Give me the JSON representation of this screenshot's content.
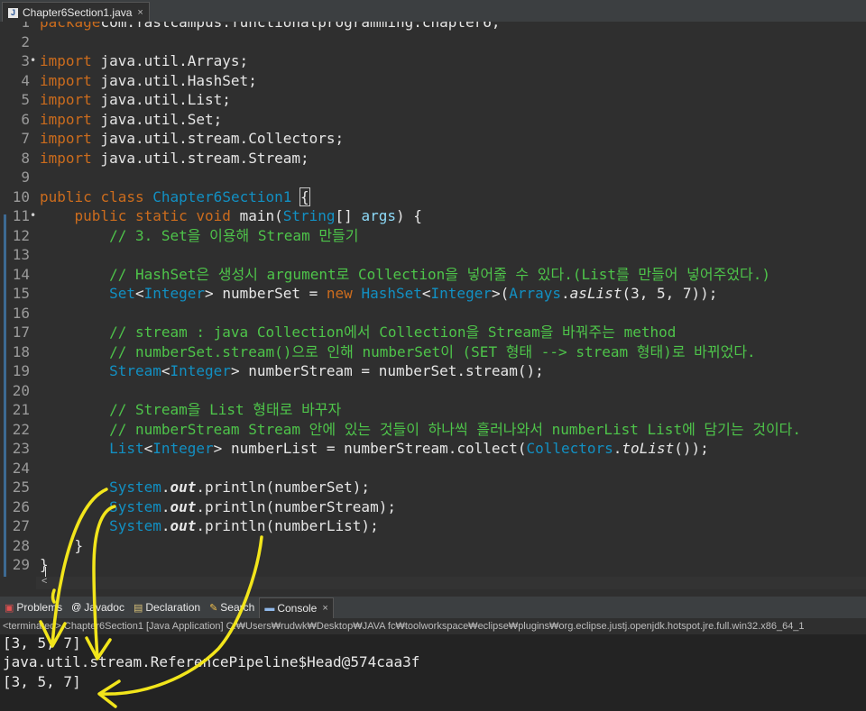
{
  "editor": {
    "tab_title": "Chapter6Section1.java",
    "tab_close": "×",
    "lines": [
      {
        "n": "1",
        "fold": "",
        "t": [
          [
            "kw",
            "package"
          ],
          [
            "",
            "com.fastcampus.functionalprogramming.chapter6;"
          ]
        ]
      },
      {
        "n": "2",
        "fold": "",
        "t": []
      },
      {
        "n": "3",
        "fold": "•",
        "t": [
          [
            "kw",
            "import"
          ],
          [
            "",
            " java.util.Arrays;"
          ]
        ]
      },
      {
        "n": "4",
        "fold": "",
        "t": [
          [
            "kw",
            "import"
          ],
          [
            "",
            " java.util.HashSet;"
          ]
        ]
      },
      {
        "n": "5",
        "fold": "",
        "t": [
          [
            "kw",
            "import"
          ],
          [
            "",
            " java.util.List;"
          ]
        ]
      },
      {
        "n": "6",
        "fold": "",
        "t": [
          [
            "kw",
            "import"
          ],
          [
            "",
            " java.util.Set;"
          ]
        ]
      },
      {
        "n": "7",
        "fold": "",
        "t": [
          [
            "kw",
            "import"
          ],
          [
            "",
            " java.util.stream.Collectors;"
          ]
        ]
      },
      {
        "n": "8",
        "fold": "",
        "t": [
          [
            "kw",
            "import"
          ],
          [
            "",
            " java.util.stream.Stream;"
          ]
        ]
      },
      {
        "n": "9",
        "fold": "",
        "t": []
      },
      {
        "n": "10",
        "fold": "",
        "t": [
          [
            "kw",
            "public"
          ],
          [
            "",
            " "
          ],
          [
            "kw",
            "class"
          ],
          [
            "",
            " "
          ],
          [
            "ty",
            "Chapter6Section1"
          ],
          [
            "",
            " "
          ],
          [
            "box",
            "{"
          ]
        ]
      },
      {
        "n": "11",
        "fold": "•",
        "t": [
          [
            "",
            "    "
          ],
          [
            "kw",
            "public"
          ],
          [
            "",
            " "
          ],
          [
            "kw",
            "static"
          ],
          [
            "",
            " "
          ],
          [
            "kw",
            "void"
          ],
          [
            "",
            " main("
          ],
          [
            "ty",
            "String"
          ],
          [
            "",
            "[] "
          ],
          [
            "fd",
            "args"
          ],
          [
            "",
            ") {"
          ]
        ]
      },
      {
        "n": "12",
        "fold": "",
        "t": [
          [
            "",
            "        "
          ],
          [
            "cm",
            "// 3. Set을 이용해 Stream 만들기"
          ]
        ]
      },
      {
        "n": "13",
        "fold": "",
        "t": []
      },
      {
        "n": "14",
        "fold": "",
        "t": [
          [
            "",
            "        "
          ],
          [
            "cm",
            "// HashSet은 생성시 argument로 Collection을 넣어줄 수 있다.(List를 만들어 넣어주었다.)"
          ]
        ]
      },
      {
        "n": "15",
        "fold": "",
        "t": [
          [
            "",
            "        "
          ],
          [
            "ty",
            "Set"
          ],
          [
            "",
            "<"
          ],
          [
            "ty",
            "Integer"
          ],
          [
            "",
            "> numberSet = "
          ],
          [
            "kw",
            "new"
          ],
          [
            "",
            " "
          ],
          [
            "ty",
            "HashSet"
          ],
          [
            "",
            "<"
          ],
          [
            "ty",
            "Integer"
          ],
          [
            "",
            ">("
          ],
          [
            "ty",
            "Arrays"
          ],
          [
            "",
            "."
          ],
          [
            "it",
            "asList"
          ],
          [
            "",
            "(3, 5, 7));"
          ]
        ]
      },
      {
        "n": "16",
        "fold": "",
        "t": []
      },
      {
        "n": "17",
        "fold": "",
        "t": [
          [
            "",
            "        "
          ],
          [
            "cm",
            "// stream : java Collection에서 Collection을 Stream을 바꿔주는 method"
          ]
        ]
      },
      {
        "n": "18",
        "fold": "",
        "t": [
          [
            "",
            "        "
          ],
          [
            "cm",
            "// numberSet.stream()으로 인해 numberSet이 (SET 형태 --> stream 형태)로 바뀌었다."
          ]
        ]
      },
      {
        "n": "19",
        "fold": "",
        "t": [
          [
            "",
            "        "
          ],
          [
            "ty",
            "Stream"
          ],
          [
            "",
            "<"
          ],
          [
            "ty",
            "Integer"
          ],
          [
            "",
            "> numberStream = numberSet.stream();"
          ]
        ]
      },
      {
        "n": "20",
        "fold": "",
        "t": []
      },
      {
        "n": "21",
        "fold": "",
        "t": [
          [
            "",
            "        "
          ],
          [
            "cm",
            "// Stream을 List 형태로 바꾸자"
          ]
        ]
      },
      {
        "n": "22",
        "fold": "",
        "t": [
          [
            "",
            "        "
          ],
          [
            "cm",
            "// numberStream Stream 안에 있는 것들이 하나씩 흘러나와서 numberList List에 담기는 것이다."
          ]
        ]
      },
      {
        "n": "23",
        "fold": "",
        "t": [
          [
            "",
            "        "
          ],
          [
            "ty",
            "List"
          ],
          [
            "",
            "<"
          ],
          [
            "ty",
            "Integer"
          ],
          [
            "",
            "> numberList = numberStream.collect("
          ],
          [
            "ty",
            "Collectors"
          ],
          [
            "",
            "."
          ],
          [
            "it",
            "toList"
          ],
          [
            "",
            "());"
          ]
        ]
      },
      {
        "n": "24",
        "fold": "",
        "t": []
      },
      {
        "n": "25",
        "fold": "",
        "t": [
          [
            "",
            "        "
          ],
          [
            "ty",
            "System"
          ],
          [
            "",
            "."
          ],
          [
            "bi",
            "out"
          ],
          [
            "",
            ".println(numberSet);"
          ]
        ]
      },
      {
        "n": "26",
        "fold": "",
        "t": [
          [
            "",
            "        "
          ],
          [
            "ty",
            "System"
          ],
          [
            "",
            "."
          ],
          [
            "bi",
            "out"
          ],
          [
            "",
            ".println(numberStream);"
          ]
        ]
      },
      {
        "n": "27",
        "fold": "",
        "t": [
          [
            "",
            "        "
          ],
          [
            "ty",
            "System"
          ],
          [
            "",
            "."
          ],
          [
            "bi",
            "out"
          ],
          [
            "",
            ".println(numberList);"
          ]
        ]
      },
      {
        "n": "28",
        "fold": "",
        "t": [
          [
            "",
            "    }"
          ]
        ]
      },
      {
        "n": "29",
        "fold": "",
        "t": [
          [
            "",
            "}"
          ]
        ]
      }
    ]
  },
  "views": {
    "problems": "Problems",
    "javadoc": "Javadoc",
    "declaration": "Declaration",
    "search": "Search",
    "console": "Console",
    "console_close": "×"
  },
  "console": {
    "terminated_line": "<terminated> Chapter6Section1 [Java Application] C:₩Users₩rudwk₩Desktop₩JAVA fc₩toolworkspace₩eclipse₩plugins₩org.eclipse.justj.openjdk.hotspot.jre.full.win32.x86_64_1",
    "output": [
      "[3, 5, 7]",
      "java.util.stream.ReferencePipeline$Head@574caa3f",
      "[3, 5, 7]"
    ]
  },
  "colors": {
    "keyword": "#cc6c1d",
    "type": "#1290c3",
    "comment": "#4ec44a",
    "field": "#8ddaf8",
    "annotation": "#f2e51b"
  }
}
